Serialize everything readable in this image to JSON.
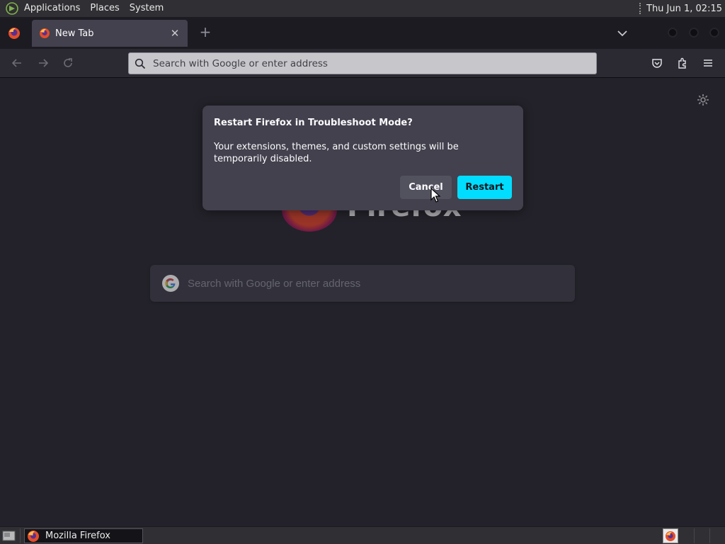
{
  "top_panel": {
    "menus": [
      "Applications",
      "Places",
      "System"
    ],
    "clock": "Thu Jun  1, 02:15"
  },
  "browser": {
    "tab_title": "New Tab",
    "new_tab_symbol": "+",
    "urlbar_placeholder": "Search with Google or enter address",
    "icons": [
      "firefox-app-icon",
      "close-icon",
      "chevron-down-icon",
      "back-arrow-icon",
      "forward-arrow-icon",
      "reload-icon",
      "search-icon",
      "pocket-icon",
      "extensions-icon",
      "hamburger-menu-icon",
      "gear-icon",
      "google-icon"
    ]
  },
  "newtab": {
    "logo_word": "Firefox",
    "search_placeholder": "Search with Google or enter address"
  },
  "dialog": {
    "title": "Restart Firefox in Troubleshoot Mode?",
    "body": "Your extensions, themes, and custom settings will be temporarily disabled.",
    "cancel_label": "Cancel",
    "restart_label": "Restart"
  },
  "taskbar": {
    "window_title": "Mozilla Firefox"
  },
  "colors": {
    "accent_button": "#00ddff",
    "dialog_bg": "#42414d",
    "page_bg": "#2b2a33",
    "tabstrip_bg": "#1c1b22"
  }
}
